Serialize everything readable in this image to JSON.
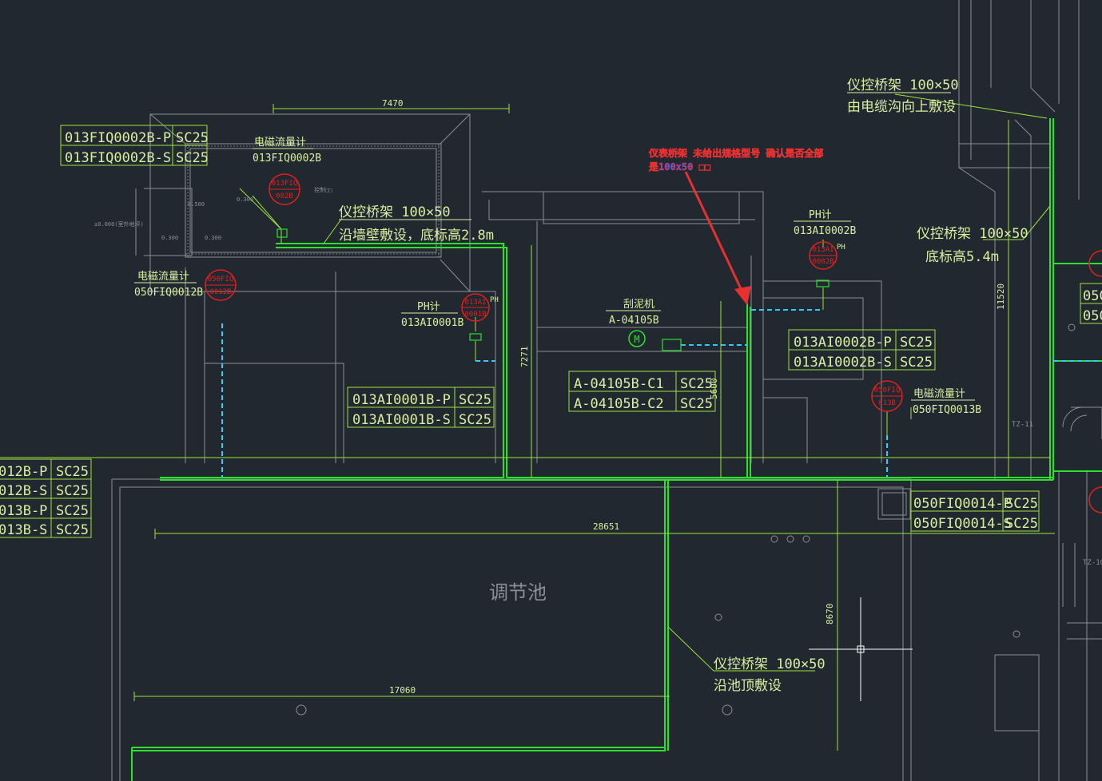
{
  "colors": {
    "background": "#212830",
    "structure": "#8a8f94",
    "cable_tray": "#2ee02e",
    "text": "#d8f0a0",
    "dimension": "#9ee040",
    "instrument": "#e02020",
    "conduit_dashed": "#35c8f0",
    "annotation_red": "#e83030",
    "annotation_blue": "#3060ff",
    "crosshair": "#ffffff"
  },
  "dimensions": {
    "top_width": "7470",
    "pool_width": "28651",
    "pool_width_lower": "17060",
    "vertical_left": "7271",
    "vertical_mid": "5600",
    "vertical_right": "11520",
    "vertical_pool": "8670"
  },
  "pool_label": "调节池",
  "instruments": [
    {
      "tag_lines": [
        "013FIQ",
        "002B"
      ],
      "name": "电磁流量计",
      "code": "013FIQ0002B"
    },
    {
      "tag_lines": [
        "050FIQ",
        "0012B"
      ],
      "name": "电磁流量计",
      "code": "050FIQ0012B"
    },
    {
      "tag_lines": [
        "013AI",
        "0001B"
      ],
      "name": "PH计",
      "code": "013AI0001B",
      "suffix": "PH"
    },
    {
      "tag_lines": [
        "013AI",
        "0002B"
      ],
      "name": "PH计",
      "code": "013AI0002B",
      "suffix": "PH"
    },
    {
      "tag_lines": [
        "050FIQ",
        "013B"
      ],
      "name": "电磁流量计",
      "code": "050FIQ0013B"
    }
  ],
  "scraper": {
    "name": "刮泥机",
    "code": "A-04105B",
    "symbol": "M"
  },
  "cable_tables": {
    "fiq0002": [
      [
        "013FIQ0002B-P",
        "SC25"
      ],
      [
        "013FIQ0002B-S",
        "SC25"
      ]
    ],
    "ai0001": [
      [
        "013AI0001B-P",
        "SC25"
      ],
      [
        "013AI0001B-S",
        "SC25"
      ]
    ],
    "ai0002": [
      [
        "013AI0002B-P",
        "SC25"
      ],
      [
        "013AI0002B-S",
        "SC25"
      ]
    ],
    "scraper": [
      [
        "A-04105B-C1",
        "SC25"
      ],
      [
        "A-04105B-C2",
        "SC25"
      ]
    ],
    "fiq0014": [
      [
        "050FIQ0014-P",
        "SC25"
      ],
      [
        "050FIQ0014-S",
        "SC25"
      ]
    ],
    "left_cut": [
      [
        "012B-P",
        "SC25"
      ],
      [
        "012B-S",
        "SC25"
      ],
      [
        "013B-P",
        "SC25"
      ],
      [
        "013B-S",
        "SC25"
      ]
    ]
  },
  "tray_notes": {
    "wall": {
      "line1": "仪控桥架 100×50",
      "line2": "沿墙壁敷设，底标高2.8m"
    },
    "trench": {
      "line1": "仪控桥架 100×50",
      "line2": "由电缆沟向上敷设"
    },
    "elev": {
      "line1": "仪控桥架 100×50",
      "line2": "底标高5.4m"
    },
    "pool_top": {
      "line1": "仪控桥架 100×50",
      "line2": "沿池顶敷设"
    }
  },
  "review_note": {
    "line1": "仪表桥架 未给出规格型号 确认是否全部",
    "line2": "是100x50 □□"
  },
  "small_labels": {
    "room": "控制□□",
    "level": "±0.000(室外地坪)",
    "tz11": "TZ-11",
    "tz10": "TZ-10",
    "elev_500": "0.500",
    "elev_300a": "0.300",
    "elev_300b": "0.300",
    "elev_300c": "0.300",
    "right_cut_a": "050",
    "right_cut_b": "050"
  }
}
